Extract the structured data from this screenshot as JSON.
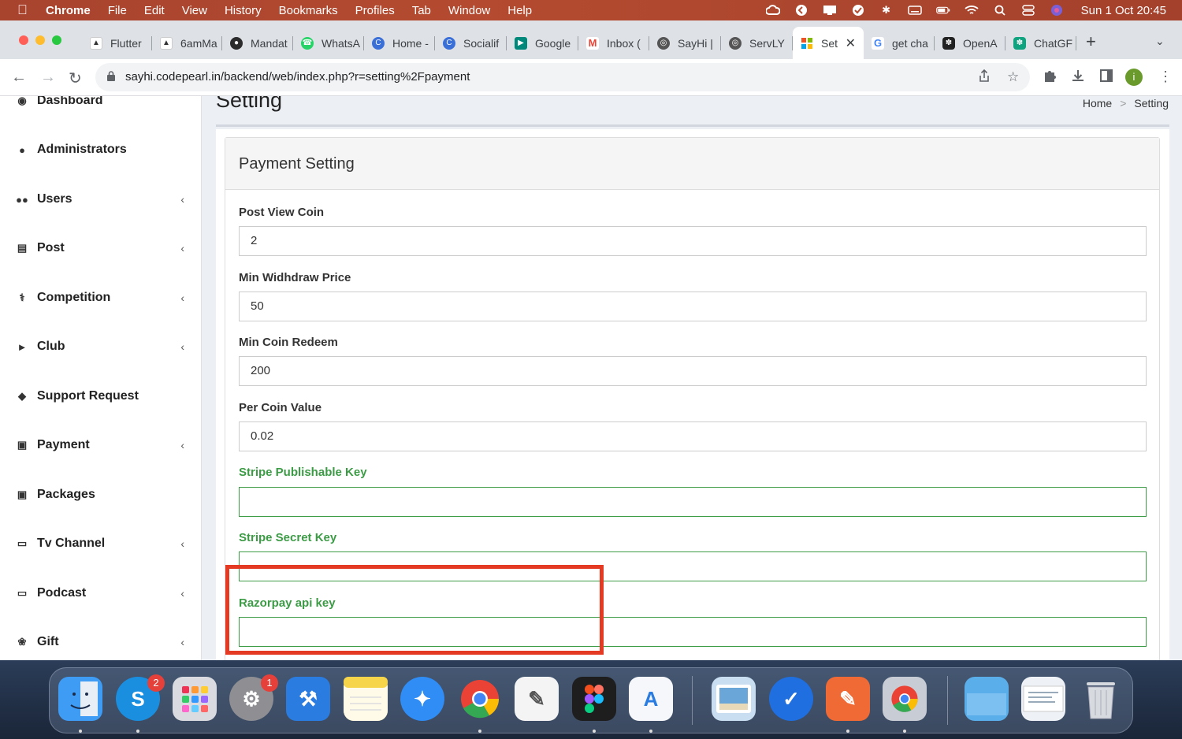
{
  "menubar": {
    "app_name": "Chrome",
    "items": [
      "File",
      "Edit",
      "View",
      "History",
      "Bookmarks",
      "Profiles",
      "Tab",
      "Window",
      "Help"
    ],
    "clock": "Sun 1 Oct  20:45"
  },
  "tabs": [
    {
      "label": "Flutter",
      "icon": "flutter-icon",
      "color": "#ffffff"
    },
    {
      "label": "6amMa",
      "icon": "flutter-icon",
      "color": "#ffffff"
    },
    {
      "label": "Mandat",
      "icon": "mandate-icon",
      "color": "#2b2b2b"
    },
    {
      "label": "WhatsA",
      "icon": "whatsapp-icon",
      "color": "#25d366"
    },
    {
      "label": "Home -",
      "icon": "c-logo-icon",
      "color": "#3b6fd8"
    },
    {
      "label": "Socialif",
      "icon": "c-logo-icon",
      "color": "#3b6fd8"
    },
    {
      "label": "Google",
      "icon": "google-meet-icon",
      "color": "#00897b"
    },
    {
      "label": "Inbox (",
      "icon": "gmail-icon",
      "color": "#ea4335"
    },
    {
      "label": "SayHi |",
      "icon": "globe-icon",
      "color": "#555555"
    },
    {
      "label": "ServLY",
      "icon": "globe-icon",
      "color": "#555555"
    },
    {
      "label": "Set",
      "icon": "windows-grid-icon",
      "color": "#f25022",
      "active": true
    },
    {
      "label": "get cha",
      "icon": "google-icon",
      "color": "#4285f4"
    },
    {
      "label": "OpenA",
      "icon": "openai-icon",
      "color": "#222222"
    },
    {
      "label": "ChatGF",
      "icon": "openai-icon",
      "color": "#10a37f"
    }
  ],
  "address_bar": {
    "url": "sayhi.codepearl.in/backend/web/index.php?r=setting%2Fpayment"
  },
  "profile_initial": "i",
  "sidebar": {
    "items": [
      {
        "label": "Dashboard",
        "icon": "dashboard-icon",
        "expandable": false
      },
      {
        "label": "Administrators",
        "icon": "user-icon",
        "expandable": false
      },
      {
        "label": "Users",
        "icon": "users-icon",
        "expandable": true
      },
      {
        "label": "Post",
        "icon": "post-icon",
        "expandable": true
      },
      {
        "label": "Competition",
        "icon": "competition-icon",
        "expandable": true
      },
      {
        "label": "Club",
        "icon": "bullhorn-icon",
        "expandable": true
      },
      {
        "label": "Support Request",
        "icon": "ticket-icon",
        "expandable": false
      },
      {
        "label": "Payment",
        "icon": "money-icon",
        "expandable": true
      },
      {
        "label": "Packages",
        "icon": "money-icon",
        "expandable": false
      },
      {
        "label": "Tv Channel",
        "icon": "tv-icon",
        "expandable": true
      },
      {
        "label": "Podcast",
        "icon": "desktop-icon",
        "expandable": true
      },
      {
        "label": "Gift",
        "icon": "gift-icon",
        "expandable": true
      }
    ]
  },
  "content": {
    "page_title": "Setting",
    "breadcrumb": {
      "home": "Home",
      "current": "Setting"
    },
    "panel_title": "Payment Setting",
    "fields": [
      {
        "label": "Post View Coin",
        "value": "2",
        "state": "normal"
      },
      {
        "label": "Min Widhdraw Price",
        "value": "50",
        "state": "normal"
      },
      {
        "label": "Min Coin Redeem",
        "value": "200",
        "state": "normal"
      },
      {
        "label": "Per Coin Value",
        "value": "0.02",
        "state": "normal"
      },
      {
        "label": "Stripe Publishable Key",
        "value": "",
        "state": "valid"
      },
      {
        "label": "Stripe Secret Key",
        "value": "",
        "state": "valid"
      },
      {
        "label": "Razorpay api key",
        "value": "",
        "state": "valid"
      }
    ]
  },
  "dock": {
    "apps": [
      {
        "name": "finder-icon",
        "color": "#3e9cf5"
      },
      {
        "name": "skype-icon",
        "color": "#1a8fe0",
        "badge": "2"
      },
      {
        "name": "launchpad-icon",
        "color": "#d9dbe0"
      },
      {
        "name": "system-settings-icon",
        "color": "#8e8e93",
        "badge": "1"
      },
      {
        "name": "xcode-icon",
        "color": "#2a7ce0"
      },
      {
        "name": "notes-icon",
        "color": "#f7d54a"
      },
      {
        "name": "safari-icon",
        "color": "#2f8df5"
      },
      {
        "name": "chrome-icon",
        "color": "#f2f2f2"
      },
      {
        "name": "textedit-icon",
        "color": "#f4f4f4"
      },
      {
        "name": "figma-icon",
        "color": "#1e1e1e"
      },
      {
        "name": "app-store-icon",
        "color": "#f5f7fb"
      },
      {
        "name": "preview-icon",
        "color": "#c9dff1"
      },
      {
        "name": "proxyman-icon",
        "color": "#1f6fe0"
      },
      {
        "name": "postman-icon",
        "color": "#f06a35"
      },
      {
        "name": "chrome-apps-icon",
        "color": "#c8cdd5"
      },
      {
        "name": "downloads-folder-icon",
        "color": "#5aaeea"
      },
      {
        "name": "document-stack-icon",
        "color": "#eef1f5"
      },
      {
        "name": "trash-icon",
        "color": "#d7dade"
      }
    ]
  }
}
